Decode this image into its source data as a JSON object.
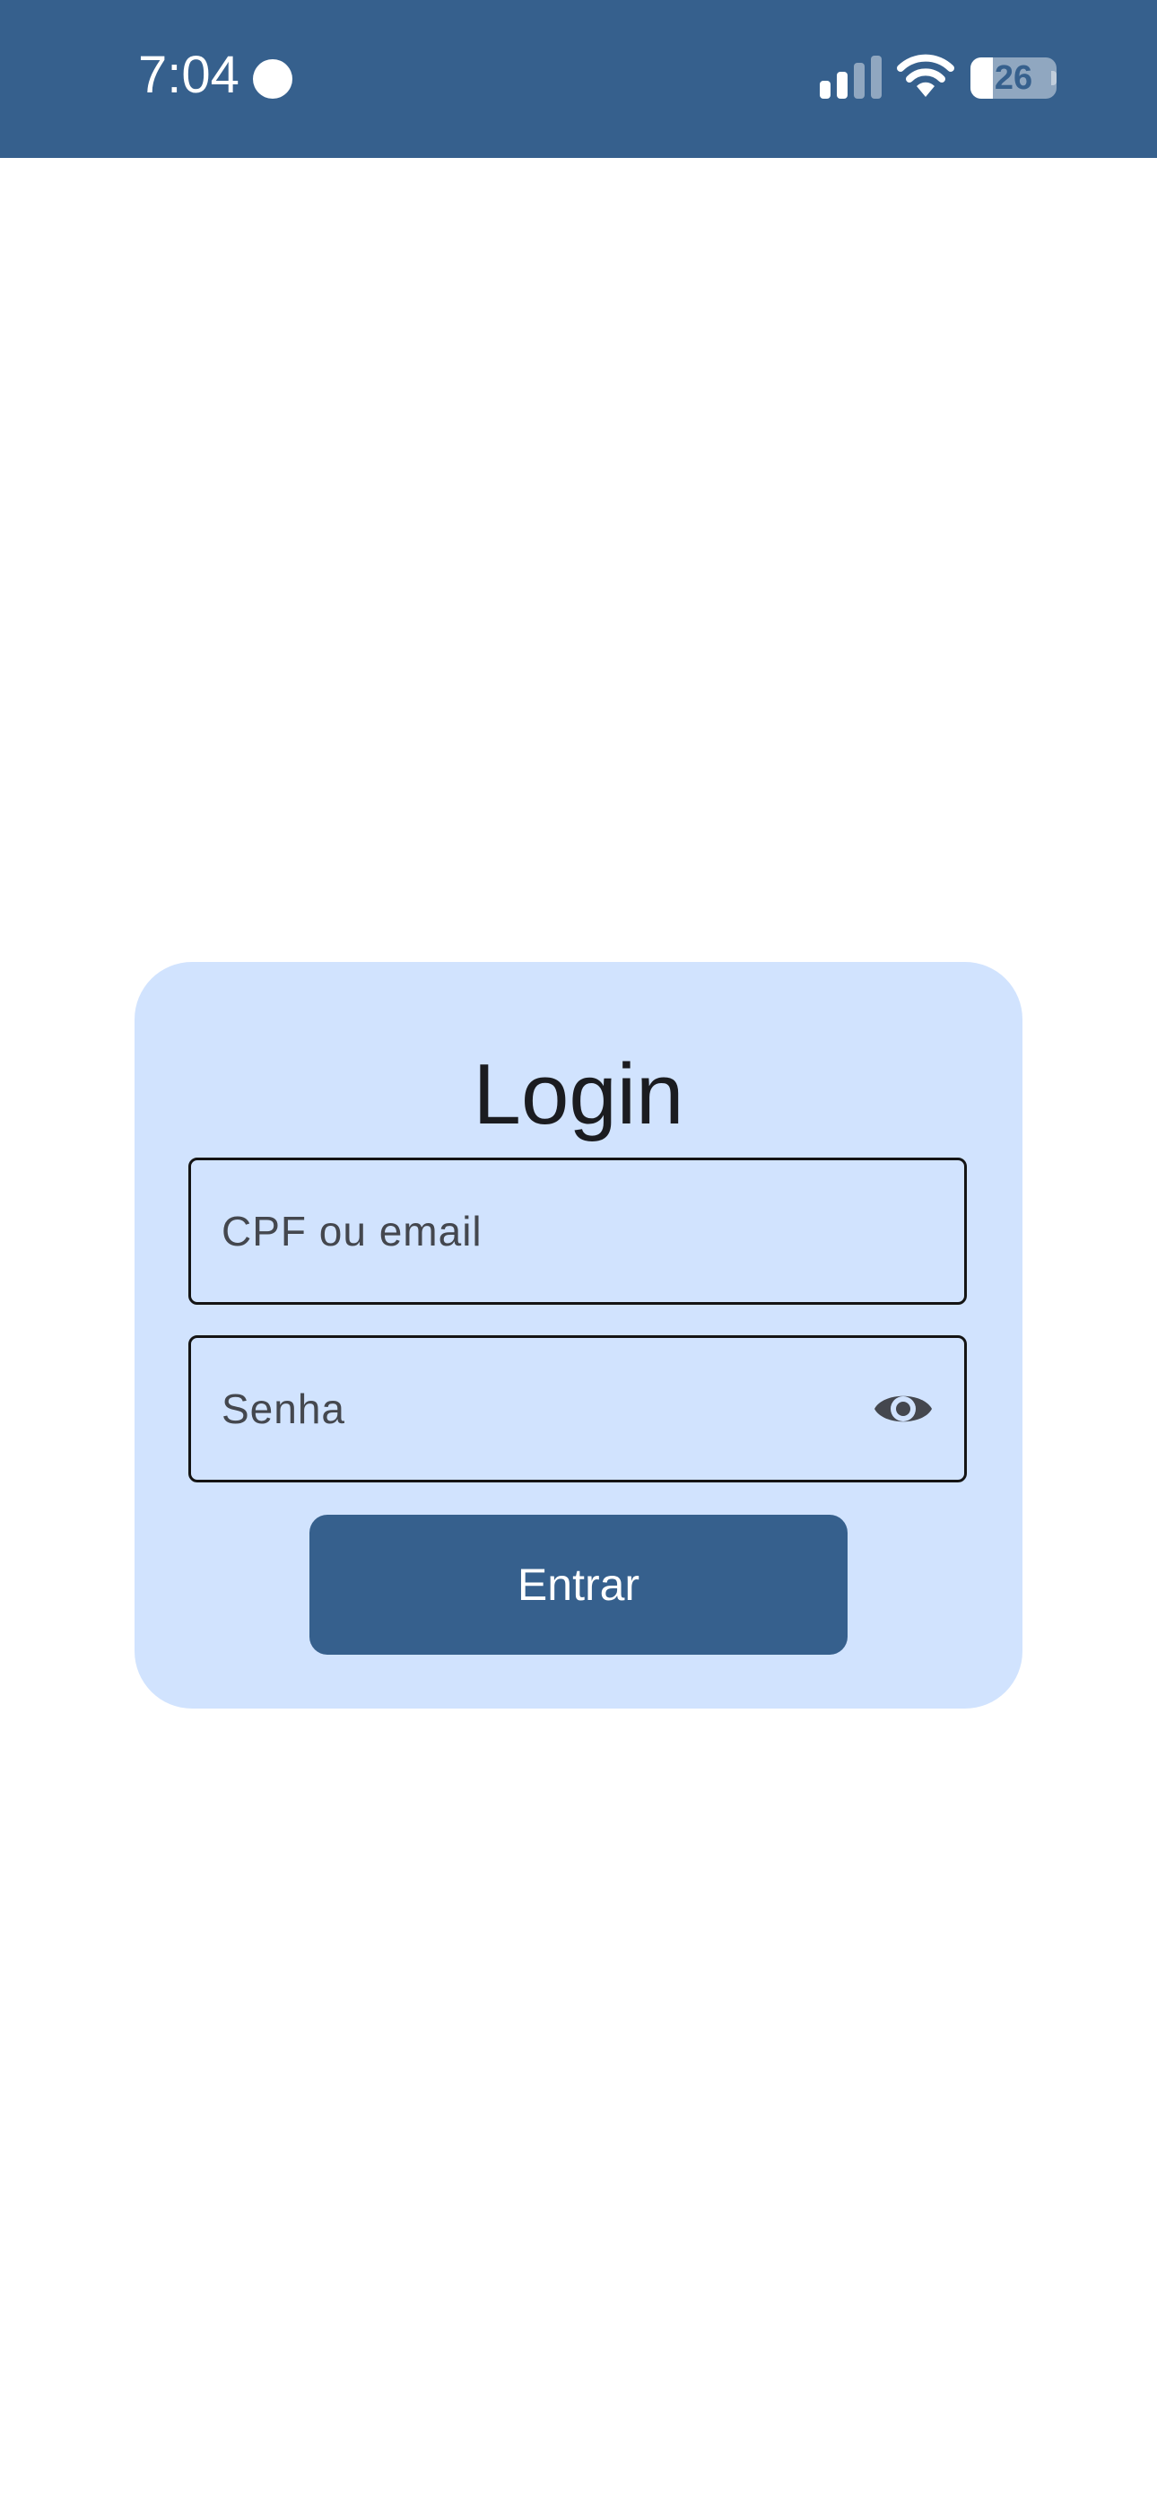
{
  "status_bar": {
    "time": "7:04",
    "battery_level": "26",
    "battery_fraction": 0.26,
    "icons": [
      "notification-dot-icon",
      "signal-icon",
      "wifi-icon",
      "battery-icon"
    ]
  },
  "login": {
    "title": "Login",
    "user_field": {
      "placeholder": "CPF ou email",
      "value": ""
    },
    "password_field": {
      "placeholder": "Senha",
      "value": "",
      "toggle_icon": "eye-icon"
    },
    "submit_label": "Entrar"
  },
  "colors": {
    "accent": "#36608d",
    "card_background": "#d1e3fe",
    "page_background": "#ffffff"
  }
}
